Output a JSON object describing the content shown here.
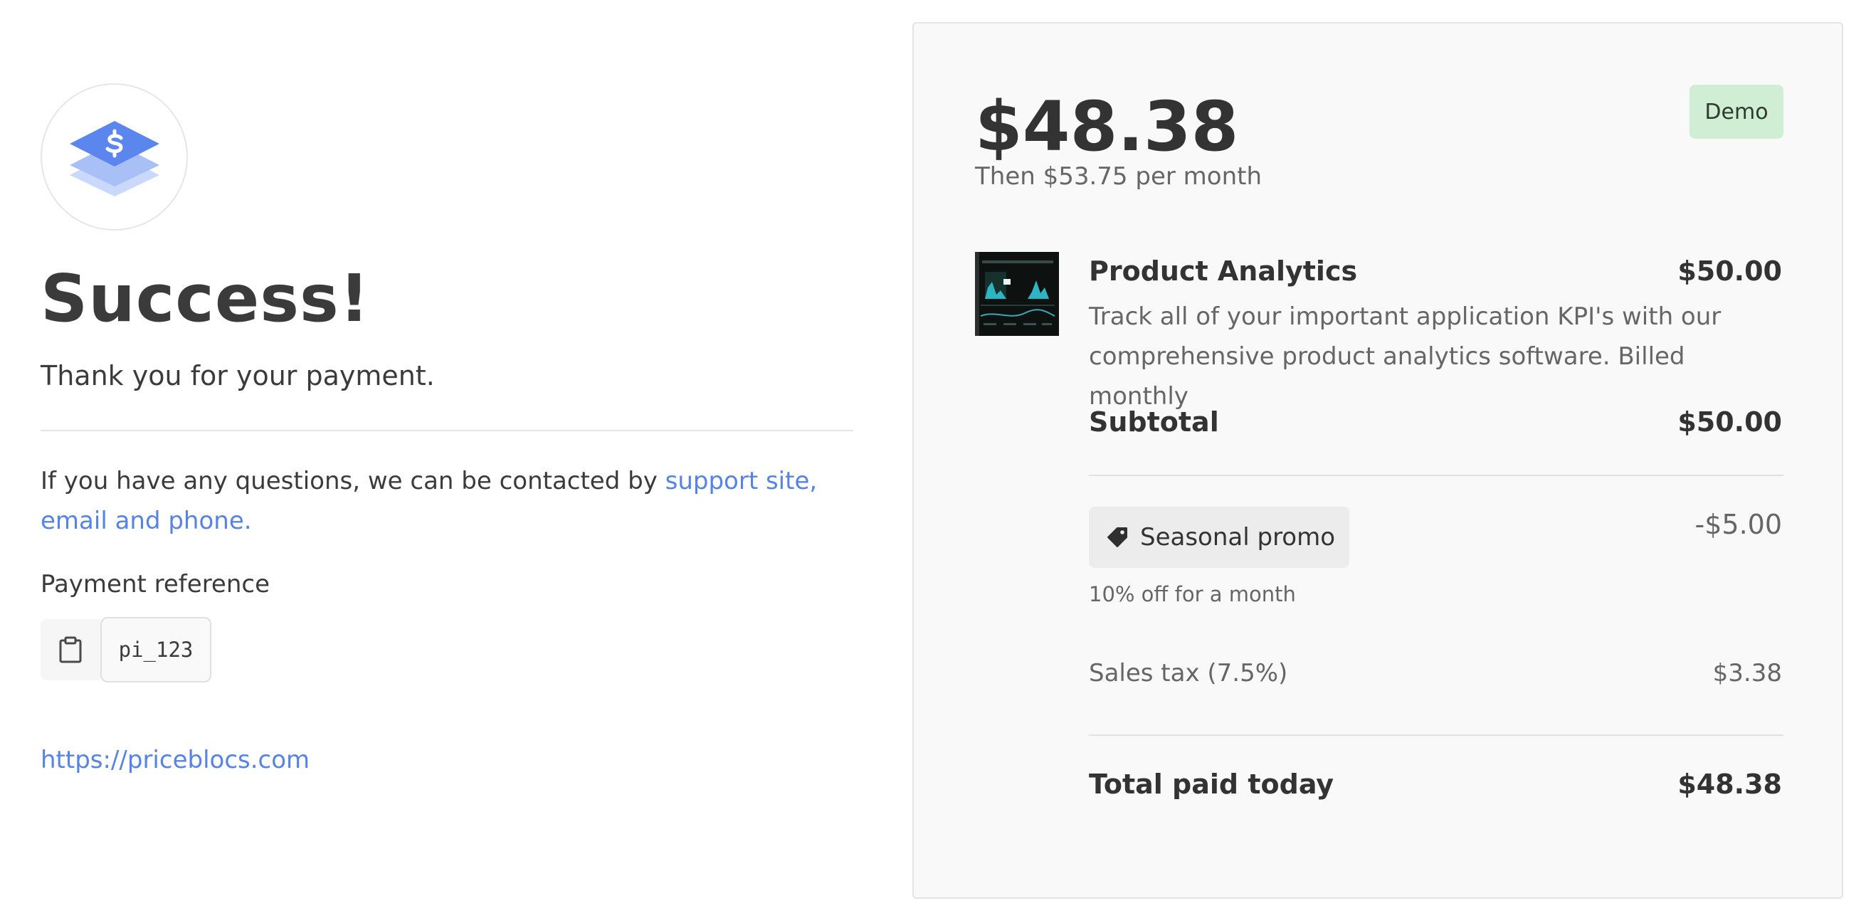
{
  "confirmation": {
    "title": "Success!",
    "subtitle": "Thank you for your payment.",
    "contact_text": "If you have any questions, we can be contacted by ",
    "contact_link": "support site, email and phone.",
    "payment_reference_label": "Payment reference",
    "payment_reference": "pi_123",
    "site_link": "https://priceblocs.com",
    "logo_icon": "dollar-stack-icon",
    "copy_icon": "clipboard-icon"
  },
  "summary": {
    "amount": "$48.38",
    "then_text": "Then $53.75 per month",
    "badge": "Demo",
    "product": {
      "name": "Product Analytics",
      "price": "$50.00",
      "description": "Track all of your important application KPI's with our comprehensive product analytics software. Billed monthly"
    },
    "subtotal_label": "Subtotal",
    "subtotal_value": "$50.00",
    "promo": {
      "icon": "tag-icon",
      "label": "Seasonal promo",
      "value": "-$5.00",
      "note": "10% off for a month"
    },
    "tax_label": "Sales tax (7.5%)",
    "tax_value": "$3.38",
    "total_label": "Total paid today",
    "total_value": "$48.38"
  },
  "colors": {
    "link": "#5583e6",
    "badge_bg": "#cfeed3",
    "panel_bg": "#f9f9f9"
  }
}
